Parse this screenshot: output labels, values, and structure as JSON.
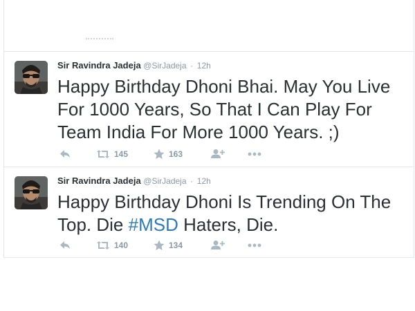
{
  "colors": {
    "name": "#292f33",
    "meta": "#8899a6",
    "hashtag": "#2b7bb9",
    "icon": "#aab8c2",
    "divider": "#e1e8ed"
  },
  "tweets": [
    {
      "fullname": "Sir Ravindra Jadeja",
      "username": "@SirJadeja",
      "separator": "·",
      "time": "12h",
      "text_before": "Happy Birthday Dhoni Bhai. May You Live For 1000 Years, So That I Can Play For Team India For More 1000 Years. ;)",
      "hashtag": "",
      "text_after": "",
      "retweets": "145",
      "favorites": "163",
      "icons": [
        "reply-icon",
        "retweet-icon",
        "favorite-icon",
        "follow-icon",
        "more-icon"
      ]
    },
    {
      "fullname": "Sir Ravindra Jadeja",
      "username": "@SirJadeja",
      "separator": "·",
      "time": "12h",
      "text_before": "Happy Birthday Dhoni Is Trending On The Top. Die ",
      "hashtag": "#MSD",
      "text_after": " Haters, Die.",
      "retweets": "140",
      "favorites": "134",
      "icons": [
        "reply-icon",
        "retweet-icon",
        "favorite-icon",
        "follow-icon",
        "more-icon"
      ]
    }
  ]
}
